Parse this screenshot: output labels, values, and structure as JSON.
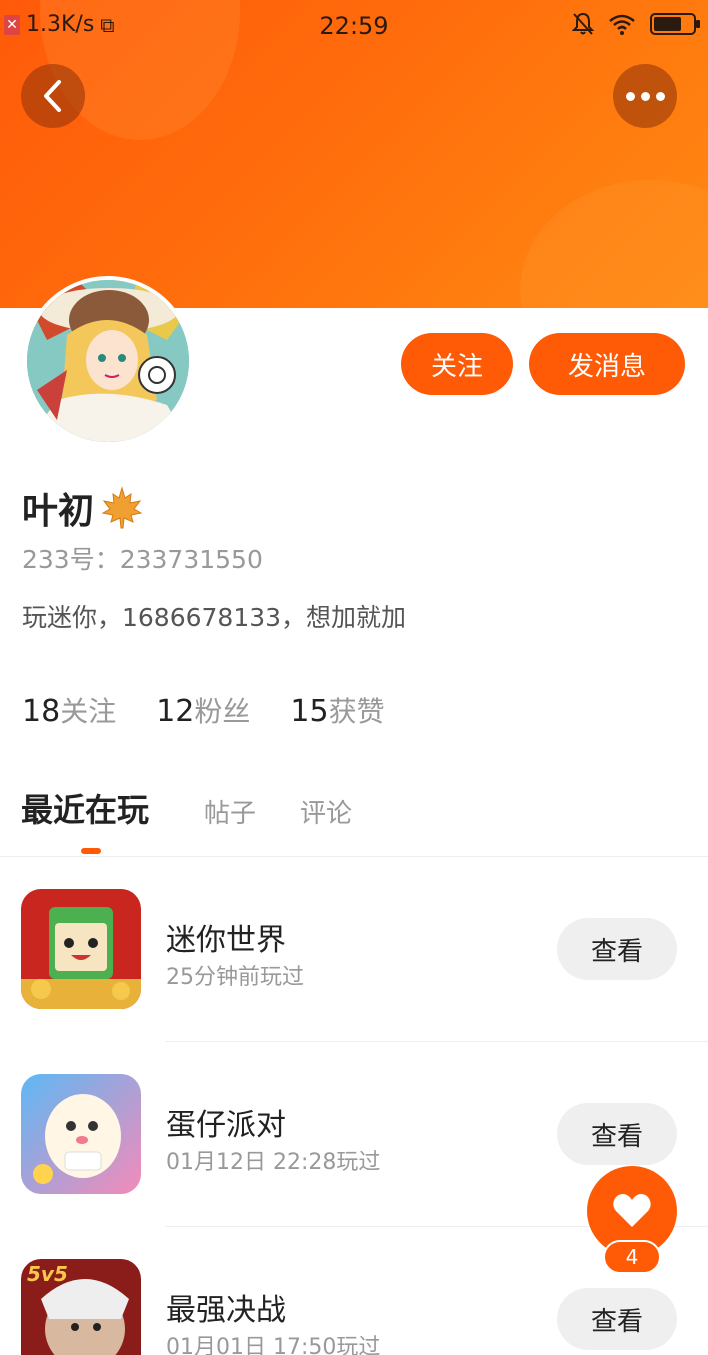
{
  "status_bar": {
    "net_speed": "1.3K/s",
    "time": "22:59",
    "battery_level": 0.7
  },
  "actions": {
    "follow_label": "关注",
    "message_label": "发消息"
  },
  "profile": {
    "name": "叶初",
    "id_line": "233号：233731550",
    "bio": "玩迷你，1686678133，想加就加"
  },
  "stats": [
    {
      "num": "18",
      "label": "关注"
    },
    {
      "num": "12",
      "label": "粉丝"
    },
    {
      "num": "15",
      "label": "获赞"
    }
  ],
  "tabs": [
    {
      "label": "最近在玩",
      "active": true
    },
    {
      "label": "帖子",
      "active": false
    },
    {
      "label": "评论",
      "active": false
    }
  ],
  "games": [
    {
      "name": "迷你世界",
      "time": "25分钟前玩过",
      "button": "查看"
    },
    {
      "name": "蛋仔派对",
      "time": "01月12日 22:28玩过",
      "button": "查看"
    },
    {
      "name": "最强决战",
      "time": "01月01日 17:50玩过",
      "button": "查看",
      "badge": "5v5"
    }
  ],
  "like": {
    "count": "4"
  },
  "colors": {
    "accent": "#ff5a06",
    "header_gradient_start": "#ff5a0a",
    "header_gradient_end": "#ff8a12"
  }
}
